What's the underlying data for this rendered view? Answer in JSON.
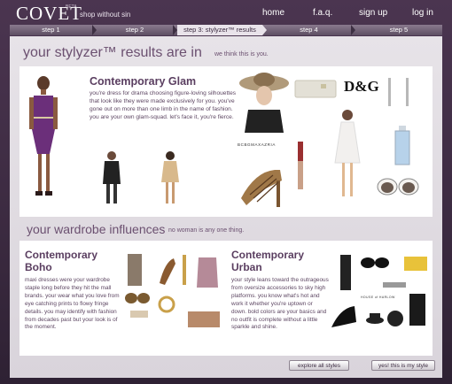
{
  "header": {
    "logo": "COVET",
    "logo_beta": "BETA",
    "tagline": "shop without sin",
    "nav": [
      "home",
      "f.a.q.",
      "sign up",
      "log in"
    ]
  },
  "steps": [
    "step 1",
    "step 2",
    "step 3: stylyzer™ results",
    "step 4",
    "step 5"
  ],
  "results": {
    "title": "your stylyzer™ results are in",
    "subtitle": "we think this is you."
  },
  "primary_style": {
    "name": "Contemporary Glam",
    "description": "you're dress for drama choosing figure-loving silhouettes that look like they were made exclusively for you. you've gone out on more than one limb in the name of fashion. you are your own glam-squad. let's face it, you're fierce."
  },
  "brands": {
    "dg": "D&G",
    "bcbg": "BCBGMAXAZRIA",
    "house": "HOUSE of HARLOW"
  },
  "influences": {
    "title": "your wardrobe influences",
    "subtitle": "no woman is any one thing.",
    "styles": [
      {
        "name_line1": "Contemporary",
        "name_line2": "Boho",
        "description": "maxi dresses were your wardrobe staple long before they hit the mall brands. your wear what you love from eye catching prints to flowy fringe details. you may identify with fashion from decades past but your look is of the moment."
      },
      {
        "name_line1": "Contemporary",
        "name_line2": "Urban",
        "description": "your style leans toward the outrageous from oversize accessories to sky high platforms. you know what's hot and work it whether you're uptown or down. bold colors are your basics and no outfit is complete without a little sparkle and shine."
      }
    ]
  },
  "buttons": {
    "explore": "explore all styles",
    "confirm": "yes! this is my style"
  },
  "colors": {
    "brand_purple": "#4b3550",
    "accent_purple": "#6b5070",
    "panel": "#e7e3e8"
  },
  "icons": [
    "dress-thumbnail",
    "bag-thumbnail",
    "shoe-thumbnail",
    "sunglasses-thumbnail",
    "perfume-thumbnail"
  ]
}
